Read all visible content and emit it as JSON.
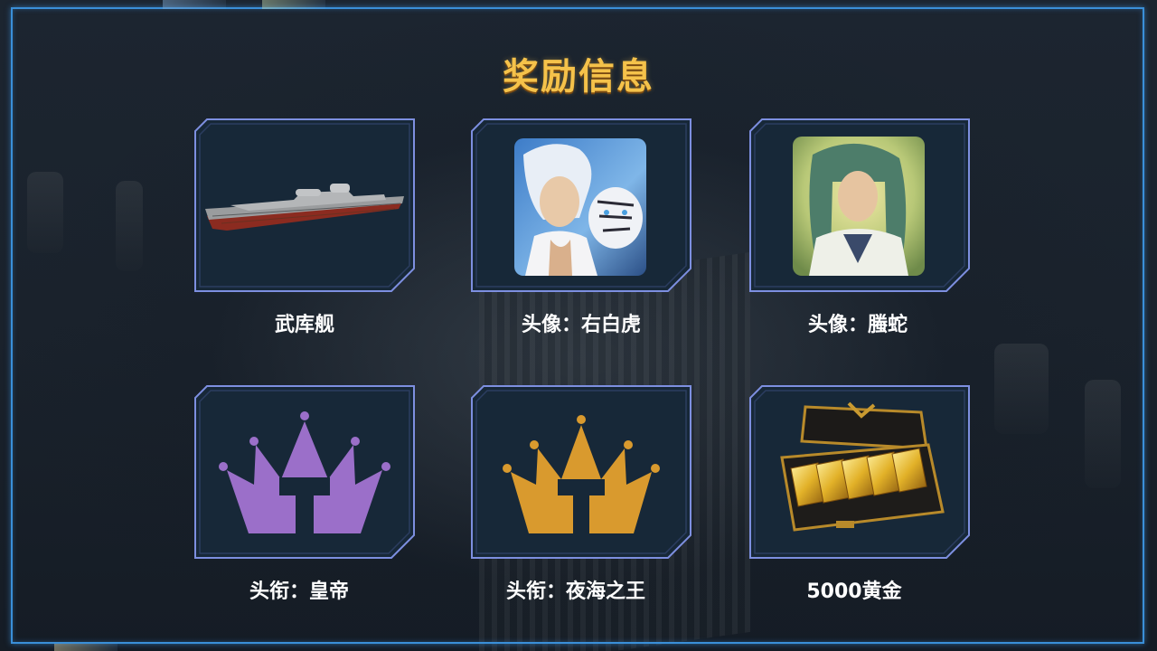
{
  "title": "奖励信息",
  "rewards": [
    {
      "label": "武库舰",
      "icon": "warship-icon"
    },
    {
      "label": "头像：右白虎",
      "icon": "white-tiger-avatar-icon"
    },
    {
      "label": "头像：螣蛇",
      "icon": "soaring-serpent-avatar-icon"
    },
    {
      "label": "头衔：皇帝",
      "icon": "purple-crown-icon"
    },
    {
      "label": "头衔：夜海之王",
      "icon": "gold-crown-icon"
    },
    {
      "label": "5000黄金",
      "icon": "gold-bars-case-icon"
    }
  ],
  "colors": {
    "title": "#f5c24a",
    "frame_border": "#3a8fd8",
    "tile_border": "#7d8fe0",
    "tile_bg": "#172838",
    "crown_purple": "#9b6fc9",
    "crown_gold": "#d99a2e"
  }
}
